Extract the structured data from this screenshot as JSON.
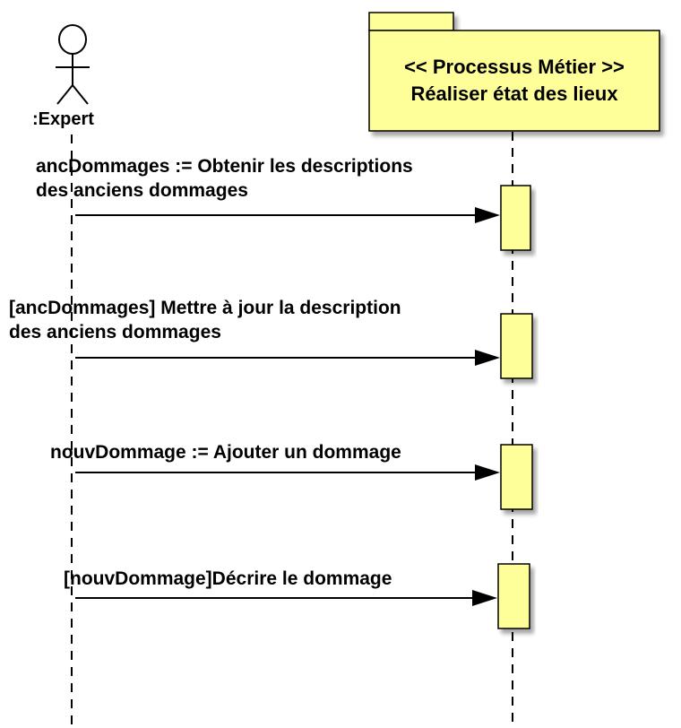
{
  "actor": {
    "label": ":Expert"
  },
  "package": {
    "stereotype": "<< Processus Métier >>",
    "name": "Réaliser état des lieux"
  },
  "messages": [
    {
      "line1": "ancDommages := Obtenir les descriptions",
      "line2": "des anciens dommages"
    },
    {
      "line1": "[ancDommages] Mettre à jour la description",
      "line2": "des anciens dommages"
    },
    {
      "line1": "nouvDommage := Ajouter un dommage",
      "line2": ""
    },
    {
      "line1": "[nouvDommage]Décrire le dommage",
      "line2": ""
    }
  ],
  "colors": {
    "box_fill": "#ffff99",
    "stroke": "#000000"
  }
}
